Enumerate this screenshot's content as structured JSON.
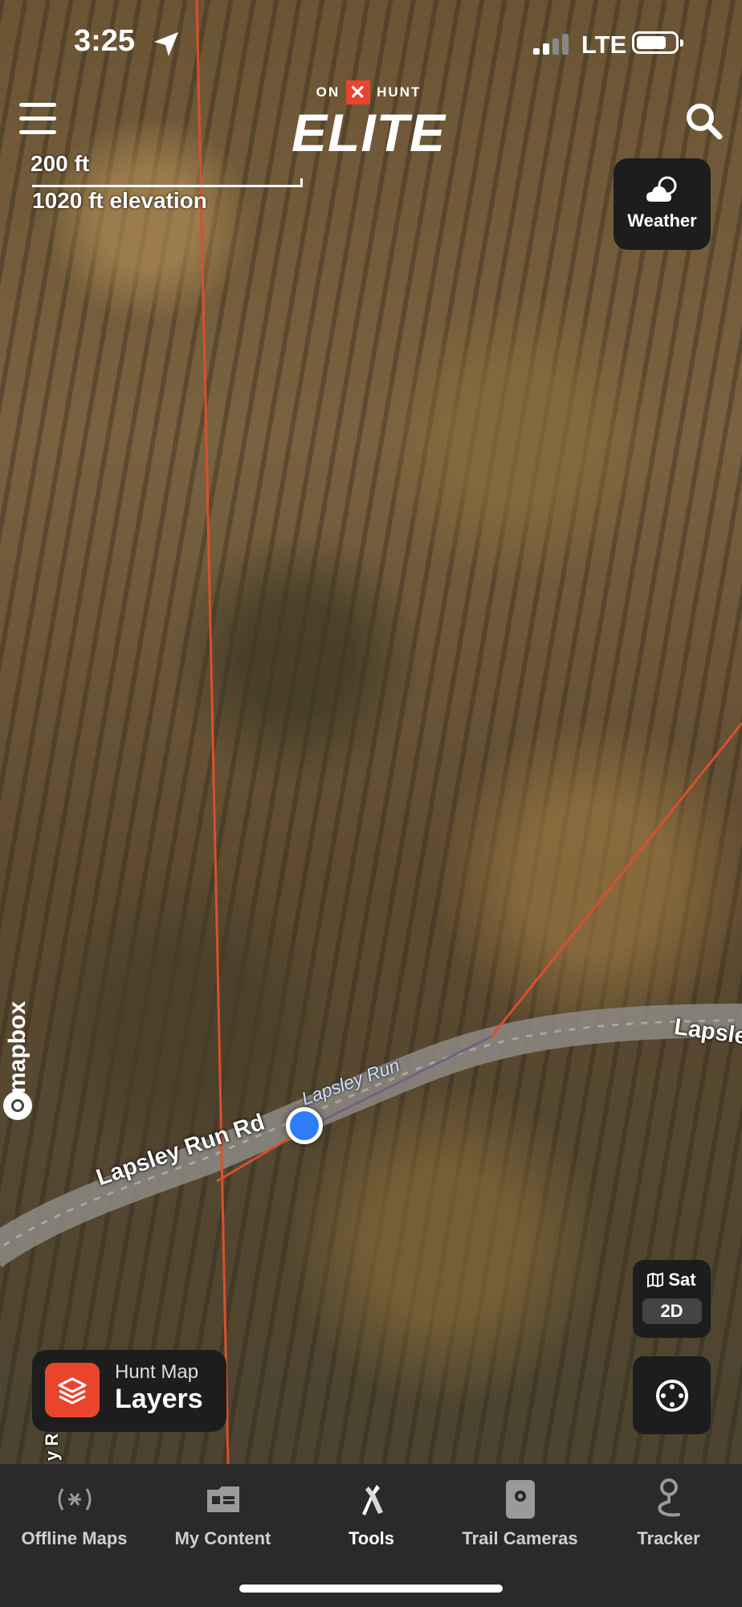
{
  "status_bar": {
    "time": "3:25",
    "network": "LTE"
  },
  "brand": {
    "top_left": "ON",
    "top_mark": "✕",
    "top_right": "HUNT",
    "name": "ELITE"
  },
  "map": {
    "scale_label": "200 ft",
    "elevation_label": "1020 ft elevation",
    "attribution": "mapbox",
    "road_labels": [
      "Lapsley Run Rd",
      "Lapsle"
    ],
    "creek_label": "Lapsley Run",
    "side_label": "y R"
  },
  "weather": {
    "label": "Weather"
  },
  "map_style": {
    "label": "Sat",
    "mode": "2D"
  },
  "layers_button": {
    "subtitle": "Hunt Map",
    "title": "Layers"
  },
  "tabs": [
    {
      "label": "Offline Maps",
      "icon": "offline-signal-icon"
    },
    {
      "label": "My Content",
      "icon": "folder-icon"
    },
    {
      "label": "Tools",
      "icon": "tools-icon"
    },
    {
      "label": "Trail Cameras",
      "icon": "trail-camera-icon"
    },
    {
      "label": "Tracker",
      "icon": "tracker-pin-icon"
    }
  ],
  "colors": {
    "accent": "#e8452c",
    "location_dot": "#2f7df6",
    "boundary_line": "#d9502c"
  }
}
